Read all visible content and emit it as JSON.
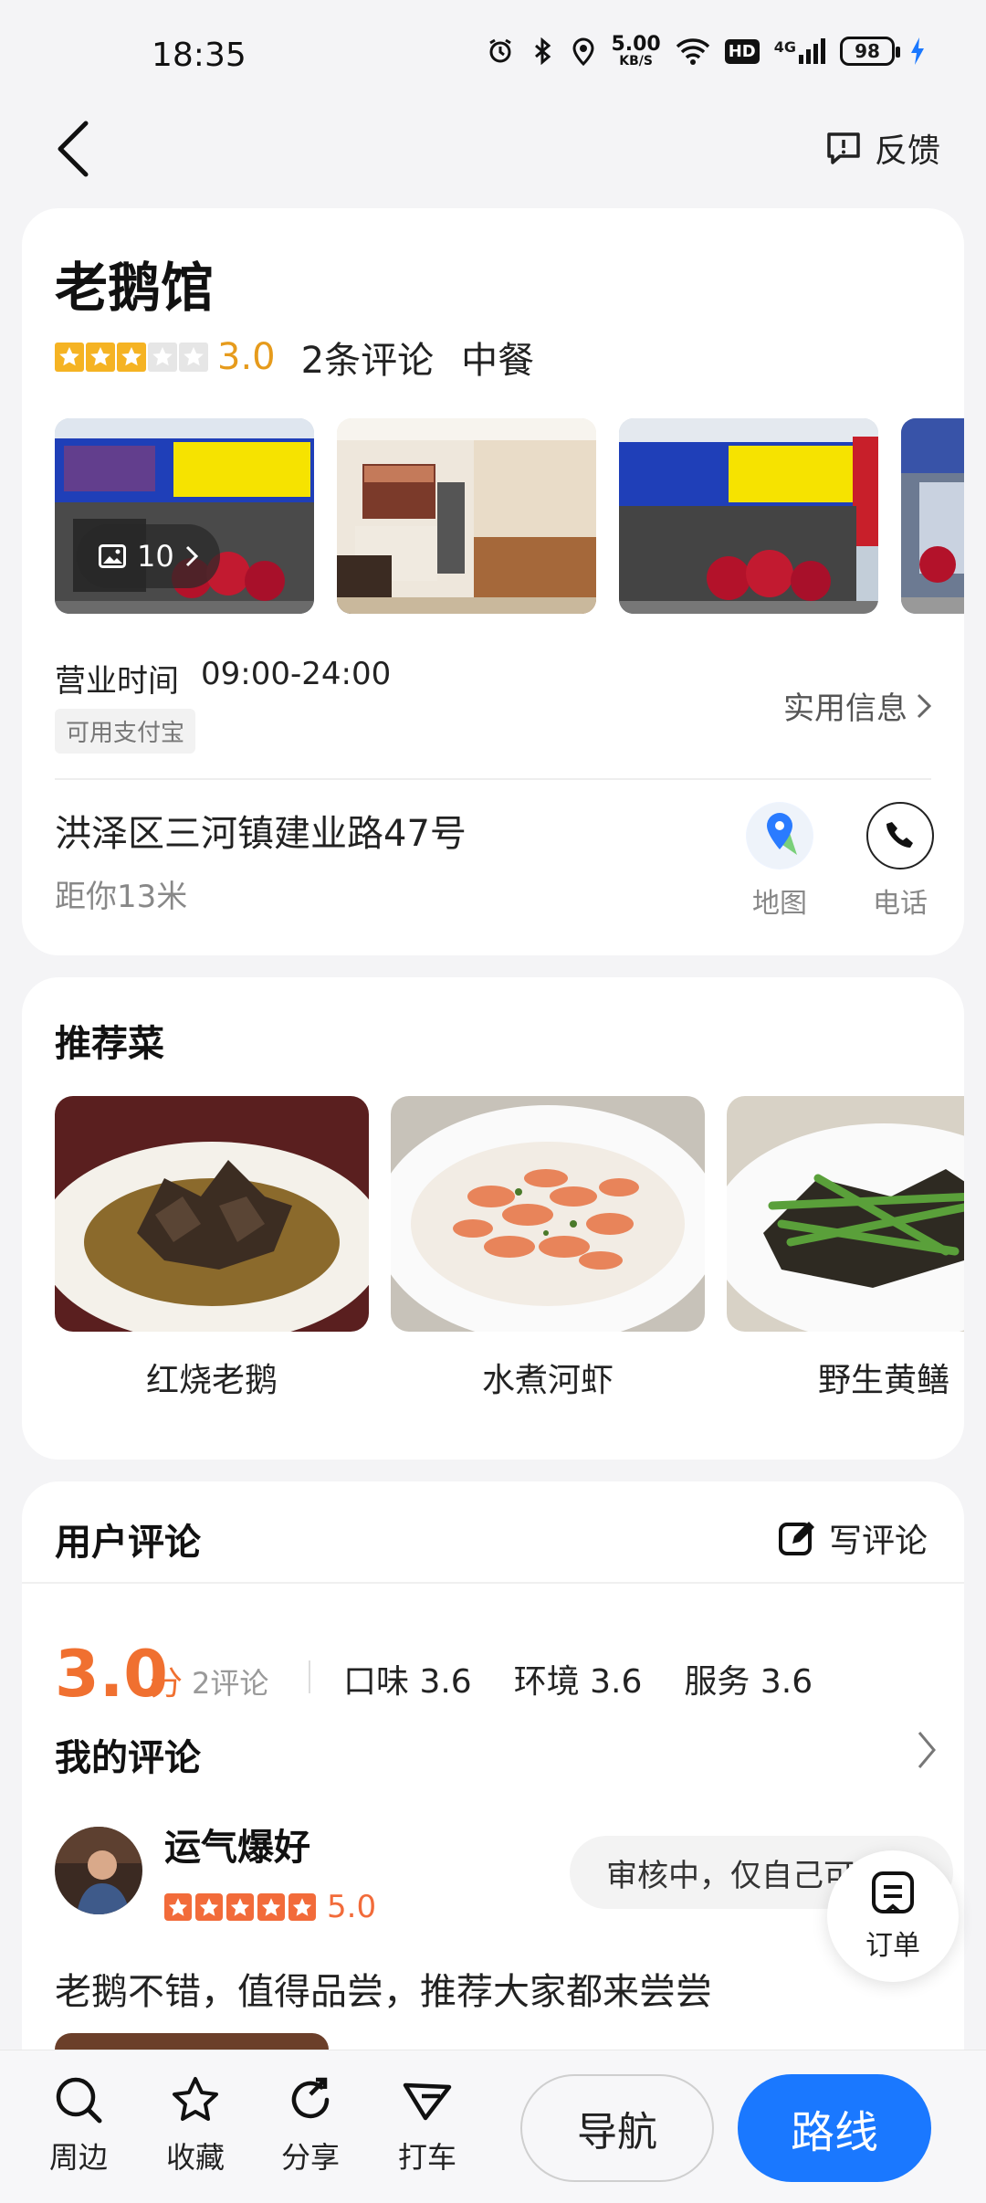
{
  "status_bar": {
    "time": "18:35",
    "net_speed_value": "5.00",
    "net_speed_unit": "KB/S",
    "hd_label": "HD",
    "network_label": "4G",
    "battery": "98"
  },
  "header": {
    "feedback_label": "反馈"
  },
  "shop": {
    "name": "老鹅馆",
    "rating_value": 3.0,
    "rating_text": "3.0",
    "review_count": "2条评论",
    "cuisine": "中餐",
    "photo_count": "10",
    "hours_label": "营业时间",
    "hours_value": "09:00-24:00",
    "pay_tag": "可用支付宝",
    "useful_info_label": "实用信息",
    "address": "洪泽区三河镇建业路47号",
    "distance": "距你13米",
    "map_label": "地图",
    "phone_label": "电话"
  },
  "dishes": {
    "title": "推荐菜",
    "items": [
      {
        "name": "红烧老鹅"
      },
      {
        "name": "水煮河虾"
      },
      {
        "name": "野生黄鳝"
      }
    ]
  },
  "reviews": {
    "title": "用户评论",
    "write_label": "写评论",
    "score": "3.0",
    "score_unit": "分",
    "score_count": "2评论",
    "sub_scores": [
      {
        "label": "口味 3.6"
      },
      {
        "label": "环境 3.6"
      },
      {
        "label": "服务 3.6"
      }
    ],
    "my_review_title": "我的评论",
    "my_review": {
      "user_name": "运气爆好",
      "score": "5.0",
      "status": "审核中，仅自己可见",
      "text": "老鹅不错，值得品尝，推荐大家都来尝尝"
    }
  },
  "fab": {
    "orders_label": "订单"
  },
  "bottom_bar": {
    "nearby": "周边",
    "favorite": "收藏",
    "share": "分享",
    "taxi": "打车",
    "navigate": "导航",
    "route": "路线"
  },
  "colors": {
    "accent_blue": "#1a78ff",
    "rating_gold": "#e69b1c",
    "score_orange": "#f07030"
  }
}
